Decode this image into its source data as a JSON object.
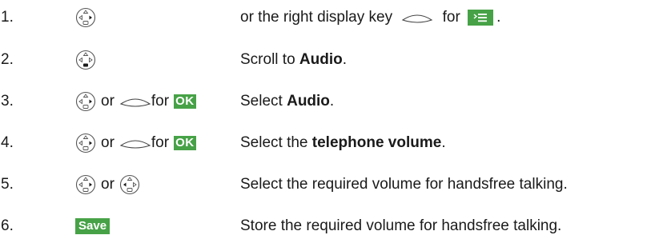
{
  "steps": [
    {
      "number": "1.",
      "keys": {
        "icon": "control-key-down-icon"
      },
      "description": {
        "prefix": "or the right display key",
        "middle": "for",
        "suffix": ".",
        "menu_icon": "menu-icon"
      }
    },
    {
      "number": "2.",
      "keys": {
        "icon": "control-key-down-icon"
      },
      "description": {
        "text": "Scroll to ",
        "bold": "Audio",
        "end": "."
      }
    },
    {
      "number": "3.",
      "keys": {
        "icon": "control-key-right-icon",
        "or": "or",
        "for": "for",
        "ok": "OK"
      },
      "description": {
        "text": "Select ",
        "bold": "Audio",
        "end": "."
      }
    },
    {
      "number": "4.",
      "keys": {
        "icon": "control-key-right-icon",
        "or": "or",
        "for": "for",
        "ok": "OK"
      },
      "description": {
        "text": "Select the ",
        "bold": "telephone volume",
        "end": "."
      }
    },
    {
      "number": "5.",
      "keys": {
        "icon": "control-key-right-icon",
        "or": "or",
        "icon2": "control-key-left-icon"
      },
      "description": {
        "text": "Select the required volume for handsfree talking."
      }
    },
    {
      "number": "6.",
      "keys": {
        "badge": "Save"
      },
      "description": {
        "text": "Store the required volume for handsfree talking."
      }
    }
  ],
  "colors": {
    "display_badge": "#47a247",
    "text": "#1a1a1a"
  }
}
